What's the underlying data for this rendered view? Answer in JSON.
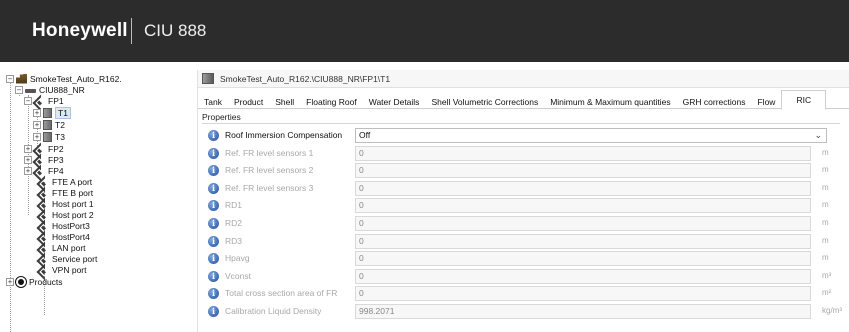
{
  "header": {
    "brand": "Honeywell",
    "product": "CIU 888"
  },
  "tree": {
    "root": "SmokeTest_Auto_R162.",
    "controller": "CIU888_NR",
    "fp1": "FP1",
    "tanks": [
      "T1",
      "T2",
      "T3"
    ],
    "fps": [
      "FP2",
      "FP3",
      "FP4"
    ],
    "ports": [
      "FTE A port",
      "FTE B port",
      "Host port 1",
      "Host port 2",
      "HostPort3",
      "HostPort4",
      "LAN port",
      "Service port",
      "VPN port"
    ],
    "products": "Products"
  },
  "pathbar": {
    "path": "SmokeTest_Auto_R162.\\CIU888_NR\\FP1\\T1"
  },
  "tabs": [
    {
      "label": "Tank",
      "active": false
    },
    {
      "label": "Product",
      "active": false
    },
    {
      "label": "Shell",
      "active": false
    },
    {
      "label": "Floating Roof",
      "active": false
    },
    {
      "label": "Water Details",
      "active": false
    },
    {
      "label": "Shell Volumetric Corrections",
      "active": false
    },
    {
      "label": "Minimum & Maximum quantities",
      "active": false
    },
    {
      "label": "GRH corrections",
      "active": false
    },
    {
      "label": "Flow",
      "active": false
    },
    {
      "label": "RIC",
      "active": true
    }
  ],
  "properties": {
    "section_label": "Properties",
    "rows": [
      {
        "label": "Roof Immersion Compensation",
        "value": "Off",
        "unit": "",
        "enabled": true,
        "dropdown": true
      },
      {
        "label": "Ref. FR level sensors 1",
        "value": "0",
        "unit": "m",
        "enabled": false,
        "dropdown": false
      },
      {
        "label": "Ref. FR level sensors 2",
        "value": "0",
        "unit": "m",
        "enabled": false,
        "dropdown": false
      },
      {
        "label": "Ref. FR level sensors 3",
        "value": "0",
        "unit": "m",
        "enabled": false,
        "dropdown": false
      },
      {
        "label": "RD1",
        "value": "0",
        "unit": "m",
        "enabled": false,
        "dropdown": false
      },
      {
        "label": "RD2",
        "value": "0",
        "unit": "m",
        "enabled": false,
        "dropdown": false
      },
      {
        "label": "RD3",
        "value": "0",
        "unit": "m",
        "enabled": false,
        "dropdown": false
      },
      {
        "label": "Hpavg",
        "value": "0",
        "unit": "m",
        "enabled": false,
        "dropdown": false
      },
      {
        "label": "Vconst",
        "value": "0",
        "unit": "m³",
        "enabled": false,
        "dropdown": false
      },
      {
        "label": "Total cross section area of FR",
        "value": "0",
        "unit": "m²",
        "enabled": false,
        "dropdown": false
      },
      {
        "label": "Calibration Liquid Density",
        "value": "998.2071",
        "unit": "kg/m³",
        "enabled": false,
        "dropdown": false
      }
    ]
  }
}
